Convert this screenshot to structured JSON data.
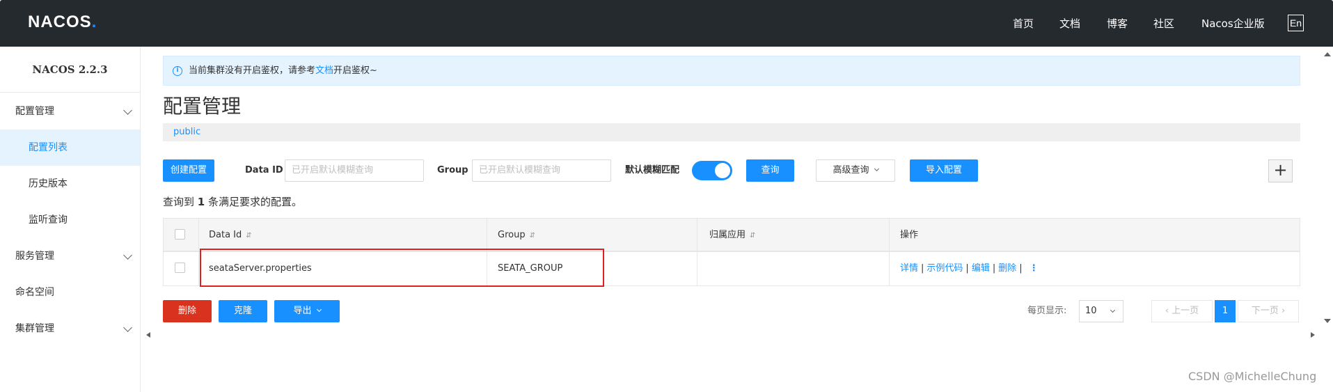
{
  "header": {
    "logo": "NACOS",
    "logo_dot": ".",
    "nav": [
      "首页",
      "文档",
      "博客",
      "社区",
      "Nacos企业版"
    ],
    "lang": "En"
  },
  "sidebar": {
    "version": "NACOS 2.2.3",
    "items": [
      {
        "label": "配置管理",
        "expandable": true
      },
      {
        "label": "配置列表",
        "active": true
      },
      {
        "label": "历史版本"
      },
      {
        "label": "监听查询"
      },
      {
        "label": "服务管理",
        "expandable": true
      },
      {
        "label": "命名空间"
      },
      {
        "label": "集群管理",
        "expandable": true
      }
    ]
  },
  "notice": {
    "prefix": "当前集群没有开启鉴权，请参考",
    "link": "文档",
    "suffix": "开启鉴权~"
  },
  "page_title": "配置管理",
  "namespace": "public",
  "toolbar": {
    "create_label": "创建配置",
    "dataid_label": "Data ID",
    "dataid_placeholder": "已开启默认模糊查询",
    "group_label": "Group",
    "group_placeholder": "已开启默认模糊查询",
    "fuzzy_label": "默认模糊匹配",
    "fuzzy_on": true,
    "query_label": "查询",
    "advanced_label": "高级查询",
    "import_label": "导入配置",
    "plus": "+"
  },
  "result": {
    "prefix": "查询到",
    "count": "1",
    "suffix": "条满足要求的配置。"
  },
  "table": {
    "columns": [
      "Data Id",
      "Group",
      "归属应用",
      "操作"
    ],
    "sort_icon": "⇵",
    "rows": [
      {
        "data_id": "seataServer.properties",
        "group": "SEATA_GROUP",
        "app": "",
        "ops": [
          "详情",
          "示例代码",
          "编辑",
          "删除"
        ]
      }
    ],
    "op_separator": "|",
    "more_icon": "⋮"
  },
  "footer": {
    "delete_label": "删除",
    "clone_label": "克隆",
    "export_label": "导出",
    "page_size_label": "每页显示:",
    "page_size": "10",
    "prev_label": "上一页",
    "next_label": "下一页",
    "current_page": "1"
  },
  "watermark": "CSDN @MichelleChung",
  "colors": {
    "primary": "#1890ff",
    "danger": "#d9321e",
    "header_bg": "#252a2f",
    "highlight": "#e02020"
  }
}
